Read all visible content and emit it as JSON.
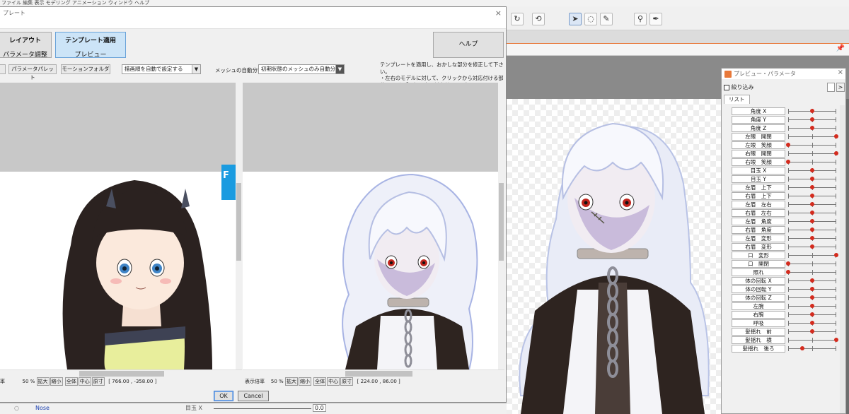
{
  "menubar": "ファイル  編集  表示  モデリング  アニメーション  ウィンドウ  ヘルプ",
  "dialog": {
    "title": "プレート",
    "close": "×",
    "tabs": {
      "layout": "レイアウト",
      "param_adjust": "パラメータ調整",
      "template_apply": "テンプレート適用",
      "preview": "プレビュー"
    },
    "help": "ヘルプ",
    "toolbar": {
      "param_palette": "パラメータパレット",
      "motion_folder": "モーションフォルダ",
      "draw_order": "描画順を自動で設定する",
      "mesh_label": "メッシュの自動分割",
      "mesh_value": "初期状態のメッシュのみ自動分割"
    },
    "note": "テンプレートを適用し、おかしな部分を修正して下さい。\n・左右のモデルに対して、クリックから対応付ける部位を選び、「選択要素を対応付け」を押して下さい。",
    "left_status": {
      "label": "率",
      "zoom": "50 %",
      "b1": "拡大",
      "b2": "縮小",
      "b3": "全体",
      "b4": "中心",
      "b5": "原寸",
      "coords": "[  766.00 , -358.00 ]"
    },
    "right_status": {
      "label": "表示倍率",
      "zoom": "50 %",
      "b1": "拡大",
      "b2": "縮小",
      "b3": "全体",
      "b4": "中心",
      "b5": "原寸",
      "coords": "[  224.00 ,   86.00 ]"
    },
    "ok": "OK",
    "cancel": "Cancel",
    "blue_tab_glyph": "F"
  },
  "bottom": {
    "nose": "Nose",
    "param": "目玉 X",
    "value": "0.0"
  },
  "panel": {
    "title": "プレビュー・パラメータ",
    "filter": "絞り込み",
    "list_tab": "リスト",
    "arrow": ">",
    "params": [
      {
        "name": "角度 X",
        "pos": 0.5
      },
      {
        "name": "角度 Y",
        "pos": 0.5
      },
      {
        "name": "角度 Z",
        "pos": 0.5
      },
      {
        "name": "左眼　開閉",
        "pos": 1.0
      },
      {
        "name": "左眼　笑顔",
        "pos": 0.0
      },
      {
        "name": "右眼　開閉",
        "pos": 1.0
      },
      {
        "name": "右眼　笑顔",
        "pos": 0.0
      },
      {
        "name": "目玉 X",
        "pos": 0.5
      },
      {
        "name": "目玉 Y",
        "pos": 0.5
      },
      {
        "name": "左眉　上下",
        "pos": 0.5
      },
      {
        "name": "右眉　上下",
        "pos": 0.5
      },
      {
        "name": "左眉　左右",
        "pos": 0.5
      },
      {
        "name": "右眉　左右",
        "pos": 0.5
      },
      {
        "name": "左眉　角度",
        "pos": 0.5
      },
      {
        "name": "右眉　角度",
        "pos": 0.5
      },
      {
        "name": "左眉　変形",
        "pos": 0.5
      },
      {
        "name": "右眉　変形",
        "pos": 0.5
      },
      {
        "name": "口　変形",
        "pos": 1.0
      },
      {
        "name": "口　開閉",
        "pos": 0.0
      },
      {
        "name": "照れ",
        "pos": 0.0
      },
      {
        "name": "体の回転 X",
        "pos": 0.5
      },
      {
        "name": "体の回転 Y",
        "pos": 0.5
      },
      {
        "name": "体の回転 Z",
        "pos": 0.5
      },
      {
        "name": "左腕",
        "pos": 0.5
      },
      {
        "name": "右腕",
        "pos": 0.5
      },
      {
        "name": "呼吸",
        "pos": 0.5
      },
      {
        "name": "髪揺れ　前",
        "pos": 0.5
      },
      {
        "name": "髪揺れ　横",
        "pos": 1.0
      },
      {
        "name": "髪揺れ　後ろ",
        "pos": 0.3
      }
    ]
  }
}
